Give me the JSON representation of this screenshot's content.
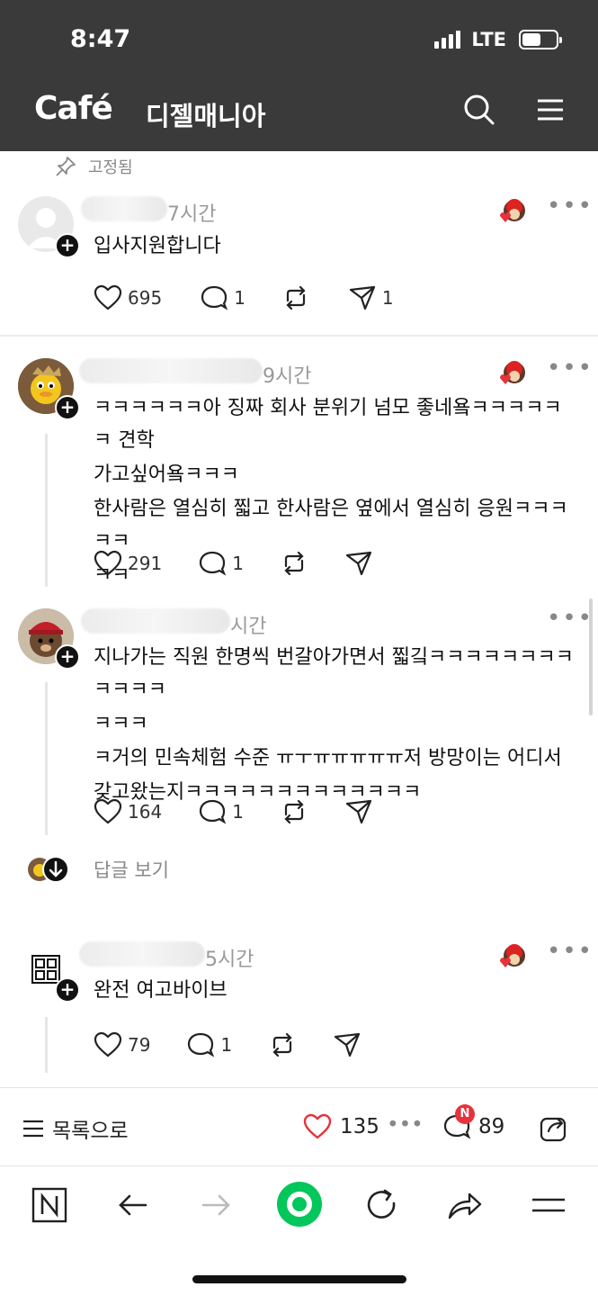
{
  "status": {
    "time": "8:47",
    "network": "LTE"
  },
  "header": {
    "logo": "Café",
    "cafe_name": "디젤매니아"
  },
  "pinned_label": "고정됨",
  "comments": [
    {
      "time": "7시간",
      "lines": [
        "입사지원합니다"
      ],
      "likes": "695",
      "replies": "1",
      "shares": "1"
    },
    {
      "time": "9시간",
      "lines": [
        "ㅋㅋㅋㅋㅋㅋ아 징짜 회사 분위기 넘모 좋네욬ㅋㅋㅋㅋㅋㅋ 견학",
        "가고싶어욬ㅋㅋㅋ",
        "한사람은 열심히 찗고 한사람은 옆에서 열심히 응원ㅋㅋㅋㅋㅋ",
        "ㅋㅋ"
      ],
      "likes": "291",
      "replies": "1"
    },
    {
      "time": "시간",
      "lines": [
        "지나가는 직원 한명씩 번갈아가면서 찗깈ㅋㅋㅋㅋㅋㅋㅋㅋㅋㅋㅋㅋ",
        "ㅋㅋㅋ",
        "ㅋ거의 민속체험 수준 ㅠㅜㅠㅠㅠㅠㅠ저 방망이는 어디서",
        "갖고왔는지ㅋㅋㅋㅋㅋㅋㅋㅋㅋㅋㅋㅋㅋ"
      ],
      "likes": "164",
      "replies": "1"
    },
    {
      "time": "5시간",
      "lines": [
        "완전 여고바이브"
      ],
      "likes": "79",
      "replies": "1"
    }
  ],
  "view_replies": "답글 보기",
  "bottom": {
    "list_label": "목록으로",
    "likes": "135",
    "comments": "89",
    "new_badge": "N"
  },
  "colors": {
    "header_bg": "#3a3a3a",
    "like_red": "#e8323c",
    "green": "#03c75a"
  }
}
